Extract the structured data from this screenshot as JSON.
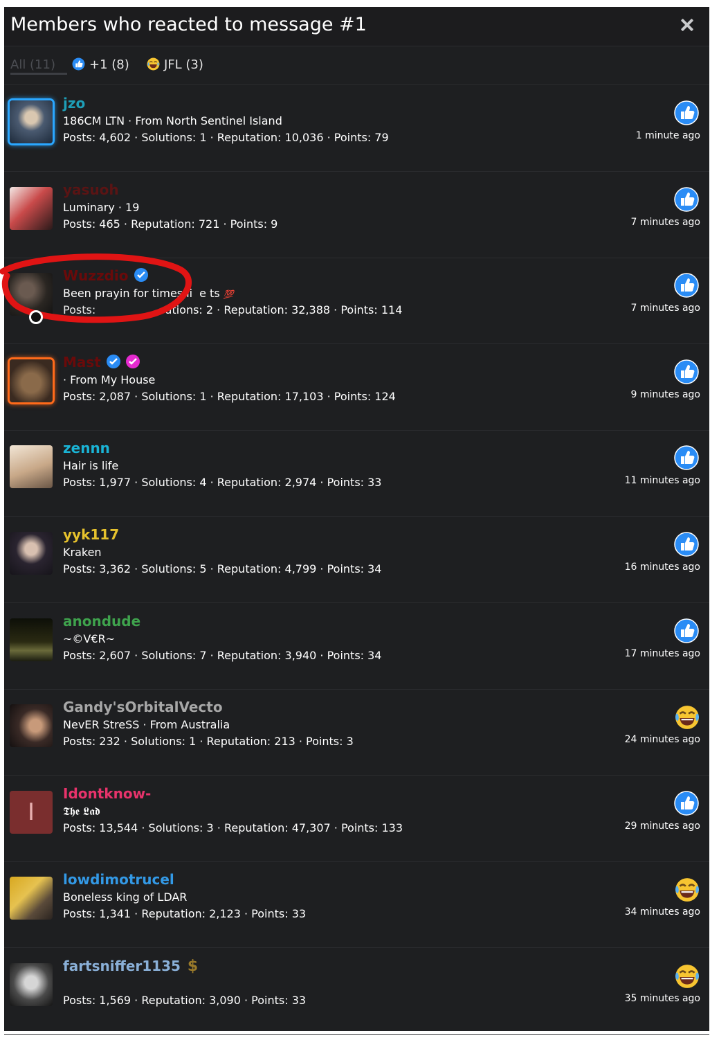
{
  "dialog": {
    "title": "Members who reacted to message #1"
  },
  "tabs": [
    {
      "label": "All (11)"
    },
    {
      "label": "+1 (8)",
      "icon": "thumbs-up-icon"
    },
    {
      "label": "JFL (3)",
      "icon": "laughing-crying-icon"
    }
  ],
  "colors": {
    "like_blue": "#2a8cf5",
    "laugh_yellow": "#f7c531",
    "annotation_red": "#e01414"
  },
  "members": [
    {
      "name": "jzo",
      "name_color": "#1e9fb8",
      "title": "186CM LTN · From North Sentinel Island",
      "stats": "Posts: 4,602 · Solutions: 1 · Reputation: 10,036 · Points: 79",
      "reaction": "like",
      "time": "1 minute ago",
      "avatar_style": "photo-blue-frame"
    },
    {
      "name": "yasuoh",
      "name_color": "#5a1414",
      "title": "Luminary · 19",
      "stats": "Posts: 465 · Reputation: 721 · Points: 9",
      "reaction": "like",
      "time": "7 minutes ago",
      "avatar_style": "photo-anime"
    },
    {
      "name": "Wuzzdio",
      "name_color": "#6a0a0a",
      "title": "Been prayin for times li",
      "title_tail": "e ts",
      "title_emoji": "💯",
      "stats": "Posts: 3,743 · Solutions: 2 · Reputation: 32,388 · Points: 114",
      "stats_tail": "utions: 2 · Reputation: 32,388 · Points: 114",
      "reaction": "like",
      "time": "7 minutes ago",
      "verified": true,
      "avatar_style": "photo-dark"
    },
    {
      "name": "Mast",
      "name_color": "#6a0a0a",
      "title": "· From My House",
      "stats": "Posts: 2,087 · Solutions: 1 · Reputation: 17,103 · Points: 124",
      "reaction": "like",
      "time": "9 minutes ago",
      "verified": true,
      "pink_badge": true,
      "avatar_style": "photo-orange-frame"
    },
    {
      "name": "zennn",
      "name_color": "#1ab4d6",
      "title": "Hair is life",
      "stats": "Posts: 1,977 · Solutions: 4 · Reputation: 2,974 · Points: 33",
      "reaction": "like",
      "time": "11 minutes ago",
      "avatar_style": "photo-light"
    },
    {
      "name": "yyk117",
      "name_color": "#e6c22d",
      "title": "Kraken",
      "stats": "Posts: 3,362 · Solutions: 5 · Reputation: 4,799 · Points: 34",
      "reaction": "like",
      "time": "16 minutes ago",
      "avatar_style": "photo-portrait"
    },
    {
      "name": "anondude",
      "name_color": "#3fa34d",
      "title": "~©V€R~",
      "stats": "Posts: 2,607 · Solutions: 7 · Reputation: 3,940 · Points: 34",
      "reaction": "like",
      "time": "17 minutes ago",
      "avatar_style": "photo-night"
    },
    {
      "name": "Gandy'sOrbitalVecto",
      "name_color": "#a7a7a7",
      "title": "NevER StreSS · From Australia",
      "stats": "Posts: 232 · Solutions: 1 · Reputation: 213 · Points: 3",
      "reaction": "jfl",
      "time": "24 minutes ago",
      "avatar_style": "photo-concert"
    },
    {
      "name": "Idontknow-",
      "name_color": "#e8336b",
      "title": "𝕿𝖍𝖊 𝕷𝖆𝖉",
      "stats": "Posts: 13,544 · Solutions: 3 · Reputation: 47,307 · Points: 133",
      "reaction": "like",
      "time": "29 minutes ago",
      "avatar_style": "letter",
      "avatar_letter": "I"
    },
    {
      "name": "lowdimotrucel",
      "name_color": "#3399e6",
      "title": "Boneless king of LDAR",
      "stats": "Posts: 1,341 · Reputation: 2,123 · Points: 33",
      "reaction": "jfl",
      "time": "34 minutes ago",
      "avatar_style": "photo-gold"
    },
    {
      "name": "fartsniffer1135",
      "name_color": "#8ab0d8",
      "title": "",
      "stats": "Posts: 1,569 · Reputation: 3,090 · Points: 33",
      "reaction": "jfl",
      "time": "35 minutes ago",
      "dollar_badge": true,
      "avatar_style": "photo-bw"
    }
  ]
}
